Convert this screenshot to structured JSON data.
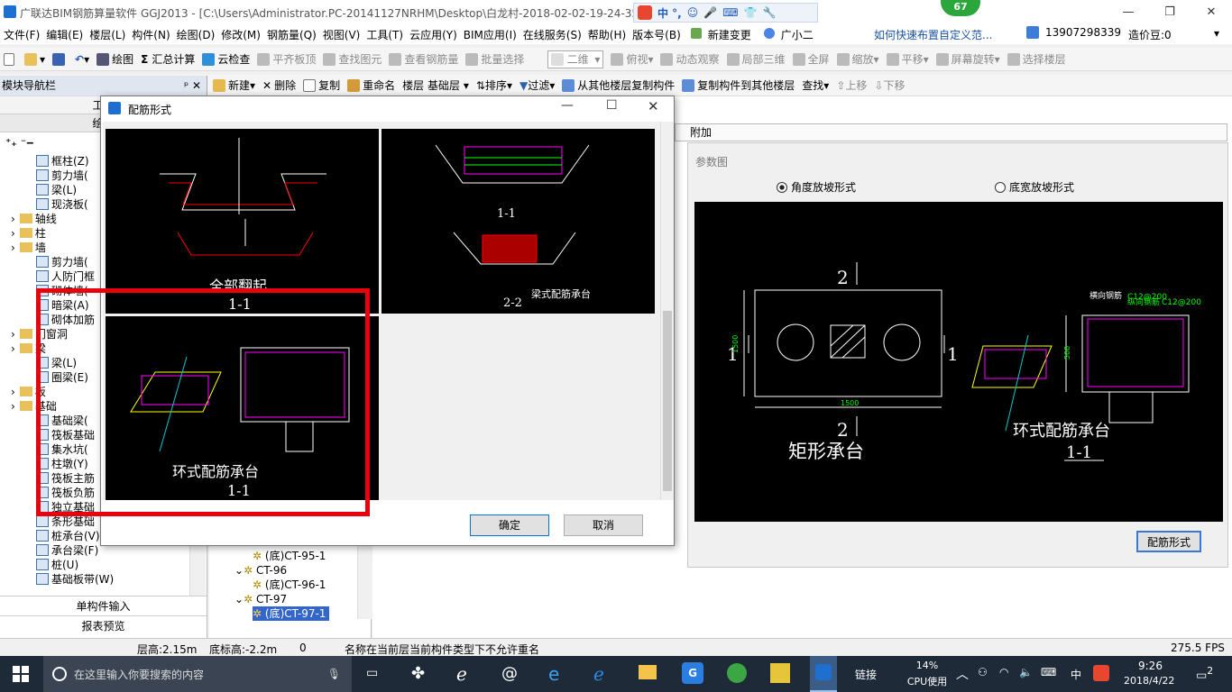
{
  "window": {
    "title": "广联达BIM钢筋算量软件 GGJ2013 - [C:\\Users\\Administrator.PC-20141127NRHM\\Desktop\\白龙村-2018-02-02-19-24-35",
    "badge": "67",
    "ime": "中 °,"
  },
  "menu": [
    "文件(F)",
    "编辑(E)",
    "楼层(L)",
    "构件(N)",
    "绘图(D)",
    "修改(M)",
    "钢筋量(Q)",
    "视图(V)",
    "工具(T)",
    "云应用(Y)",
    "BIM应用(I)",
    "在线服务(S)",
    "帮助(H)",
    "版本号(B)",
    "新建变更",
    "广小二"
  ],
  "menu_right": {
    "link": "如何快速布置自定义范...",
    "phone": "13907298339",
    "price": "造价豆:0"
  },
  "toolbar1": {
    "draw": "绘图",
    "sum": "汇总计算",
    "cloud": "云检查",
    "flat": "平齐板顶",
    "find": "查找图元",
    "view_qty": "查看钢筋量",
    "batch": "批量选择",
    "view_mode": "二维",
    "top": "俯视",
    "dynamic": "动态观察",
    "local3d": "局部三维",
    "full": "全屏",
    "zoom": "缩放",
    "pan": "平移",
    "rotate": "屏幕旋转",
    "select_floor": "选择楼层"
  },
  "toolbar2": {
    "nav_title": "模块导航栏",
    "new": "新建",
    "delete": "删除",
    "copy": "复制",
    "rename": "重命名",
    "floor_label": "楼层",
    "floor_value": "基础层",
    "sort": "排序",
    "filter": "过滤",
    "copy_from": "从其他楼层复制构件",
    "copy_to": "复制构件到其他楼层",
    "search": "查找",
    "up": "上移",
    "down": "下移"
  },
  "leftnav": {
    "tab1": "工程",
    "tab2": "绘图",
    "items": [
      "框柱(Z)",
      "剪力墙(",
      "梁(L)",
      "现浇板(",
      "轴线",
      "柱",
      "墙",
      "剪力墙(",
      "人防门框",
      "砌体墙(",
      "暗梁(A)",
      "砌体加筋",
      "门窗洞",
      "梁",
      "梁(L)",
      "圈梁(E)",
      "板",
      "基础",
      "基础梁(",
      "筏板基础",
      "集水坑(",
      "柱墩(Y)",
      "筏板主筋",
      "筏板负筋",
      "独立基础",
      "条形基础",
      "桩承台(V)",
      "承台梁(F)",
      "桩(U)",
      "基础板带(W)"
    ],
    "bottom1": "单构件输入",
    "bottom2": "报表预览"
  },
  "complist": [
    "(底)CT-95-1",
    "CT-96",
    "(底)CT-96-1",
    "CT-97",
    "(底)CT-97-1"
  ],
  "dialog": {
    "title": "配筋形式",
    "p1_title": "全部翻起",
    "p1_section": "1-1",
    "p2_label": "梁式配筋承台",
    "p2_sec1": "1-1",
    "p2_sec2": "2-2",
    "p3_title": "环式配筋承台",
    "p3_section": "1-1",
    "ok": "确定",
    "cancel": "取消"
  },
  "rightpanel": {
    "tab": "附加",
    "header": "参数图",
    "radio1": "角度放坡形式",
    "radio2": "底宽放坡形式",
    "rect_title": "矩形承台",
    "ring_title": "环式配筋承台",
    "ring_section": "1-1",
    "dim": "1500",
    "dim500": "500",
    "label_1": "1",
    "label_2": "2",
    "lbl_hjg": "横向钢筋",
    "lbl_zjg": "纵向钢筋",
    "lbl_c12": "C12@200",
    "btn": "配筋形式"
  },
  "status": {
    "floor_h": "层高:2.15m",
    "bottom_h": "底标高:-2.2m",
    "zero": "0",
    "msg": "名称在当前层当前构件类型下不允许重名",
    "fps": "275.5 FPS"
  },
  "taskbar": {
    "search": "在这里输入你要搜索的内容",
    "link": "链接",
    "cpu_pct": "14%",
    "cpu": "CPU使用",
    "lang": "中",
    "time": "9:26",
    "date": "2018/4/22",
    "notif": "2"
  }
}
